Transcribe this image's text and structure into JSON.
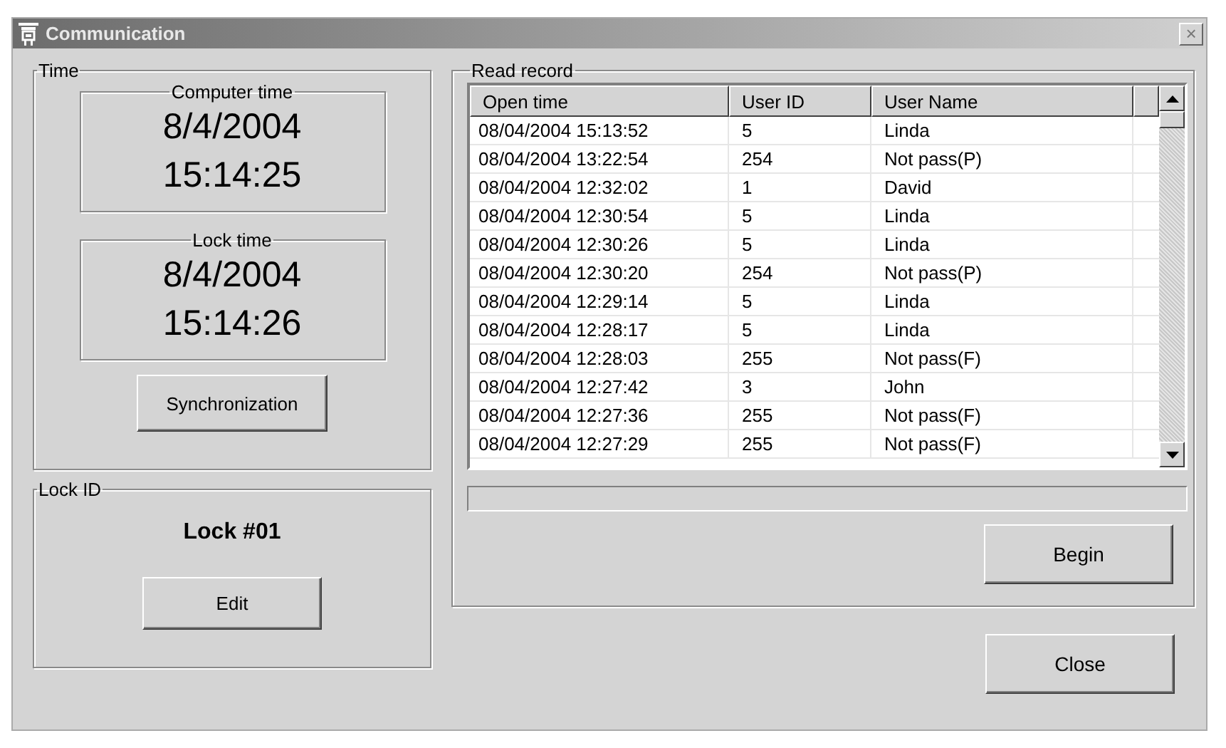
{
  "window": {
    "title": "Communication",
    "close": "×"
  },
  "time": {
    "label": "Time",
    "computer": {
      "label": "Computer time",
      "date": "8/4/2004",
      "time": "15:14:25"
    },
    "lock": {
      "label": "Lock time",
      "date": "8/4/2004",
      "time": "15:14:26"
    },
    "button": "Synchronization"
  },
  "lock_id": {
    "label": "Lock ID",
    "value": "Lock #01",
    "button": "Edit"
  },
  "read_record": {
    "label": "Read record",
    "columns": [
      "Open time",
      "User ID",
      "User Name"
    ],
    "rows": [
      [
        "08/04/2004 15:13:52",
        "5",
        "Linda"
      ],
      [
        "08/04/2004 13:22:54",
        "254",
        "Not pass(P)"
      ],
      [
        "08/04/2004 12:32:02",
        "1",
        "David"
      ],
      [
        "08/04/2004 12:30:54",
        "5",
        "Linda"
      ],
      [
        "08/04/2004 12:30:26",
        "5",
        "Linda"
      ],
      [
        "08/04/2004 12:30:20",
        "254",
        "Not pass(P)"
      ],
      [
        "08/04/2004 12:29:14",
        "5",
        "Linda"
      ],
      [
        "08/04/2004 12:28:17",
        "5",
        "Linda"
      ],
      [
        "08/04/2004 12:28:03",
        "255",
        "Not pass(F)"
      ],
      [
        "08/04/2004 12:27:42",
        "3",
        "John"
      ],
      [
        "08/04/2004 12:27:36",
        "255",
        "Not pass(F)"
      ],
      [
        "08/04/2004 12:27:29",
        "255",
        "Not pass(F)"
      ]
    ],
    "progress": {
      "level": 0
    },
    "button": "Begin"
  },
  "buttons": [
    "Close"
  ]
}
